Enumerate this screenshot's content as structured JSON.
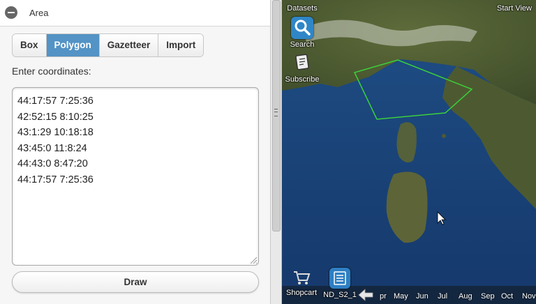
{
  "panel": {
    "title": "Area",
    "tabs": [
      {
        "label": "Box",
        "active": false
      },
      {
        "label": "Polygon",
        "active": true
      },
      {
        "label": "Gazetteer",
        "active": false
      },
      {
        "label": "Import",
        "active": false
      }
    ],
    "coords_label": "Enter coordinates:",
    "coordinates": [
      "44:17:57 7:25:36",
      "42:52:15 8:10:25",
      "43:1:29 10:18:18",
      "43:45:0 11:8:24",
      "44:43:0 8:47:20",
      "44:17:57 7:25:36"
    ],
    "draw_label": "Draw"
  },
  "map": {
    "toolbar": {
      "datasets_label": "Datasets",
      "search_label": "Search",
      "subscribe_label": "Subscribe",
      "start_view_label": "Start View"
    },
    "bottom": {
      "shopcart_label": "Shopcart",
      "product_label": "ND_S2_1"
    },
    "months": [
      "pr",
      "May",
      "Jun",
      "Jul",
      "Aug",
      "Sep",
      "Oct",
      "Nov"
    ],
    "polygon_color": "#3ad23a"
  },
  "colors": {
    "tab_active": "#5393c5",
    "search_icon_bg": "#2f86c7",
    "product_icon_bg": "#2d7fc3"
  }
}
